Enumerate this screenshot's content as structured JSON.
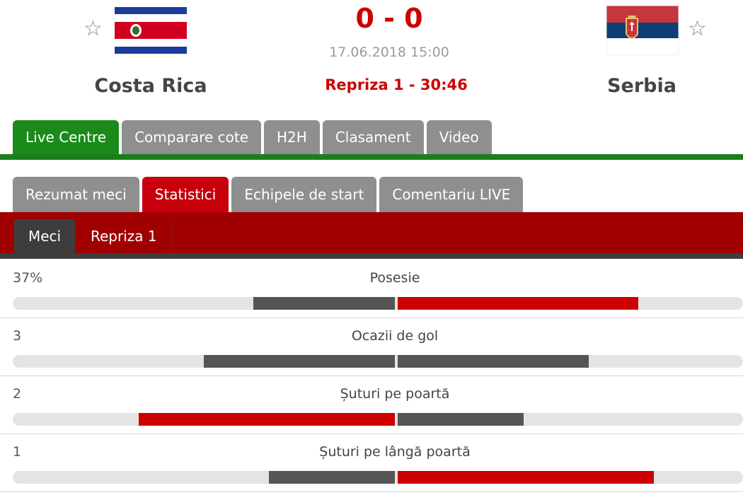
{
  "match": {
    "home": {
      "name": "Costa Rica",
      "flag": "costa-rica-flag"
    },
    "away": {
      "name": "Serbia",
      "flag": "serbia-flag"
    },
    "score": "0 - 0",
    "datetime": "17.06.2018 15:00",
    "period": "Repriza 1 - 30:46",
    "favorite_icon": "star-outline-icon"
  },
  "main_tabs": [
    "Live Centre",
    "Comparare cote",
    "H2H",
    "Clasament",
    "Video"
  ],
  "detail_tabs": [
    "Rezumat meci",
    "Statistici",
    "Echipele de start",
    "Comentariu LIVE"
  ],
  "sub_tabs": [
    "Meci",
    "Repriza 1"
  ],
  "stats": [
    {
      "home_value": "37%",
      "label": "Posesie",
      "home_fraction": 0.37,
      "away_fraction": 0.63,
      "home_color": "#555555",
      "away_color": "#cc0000"
    },
    {
      "home_value": "3",
      "label": "Ocazii de gol",
      "home_fraction": 0.5,
      "away_fraction": 0.5,
      "home_color": "#555555",
      "away_color": "#555555"
    },
    {
      "home_value": "2",
      "label": "Șuturi pe poartă",
      "home_fraction": 0.67,
      "away_fraction": 0.33,
      "home_color": "#cc0000",
      "away_color": "#555555"
    },
    {
      "home_value": "1",
      "label": "Șuturi pe lângă poartă",
      "home_fraction": 0.33,
      "away_fraction": 0.67,
      "home_color": "#555555",
      "away_color": "#cc0000"
    }
  ],
  "colors": {
    "accent_green": "#1a8a1a",
    "accent_red": "#c8000c",
    "dark": "#3d3d3d"
  }
}
